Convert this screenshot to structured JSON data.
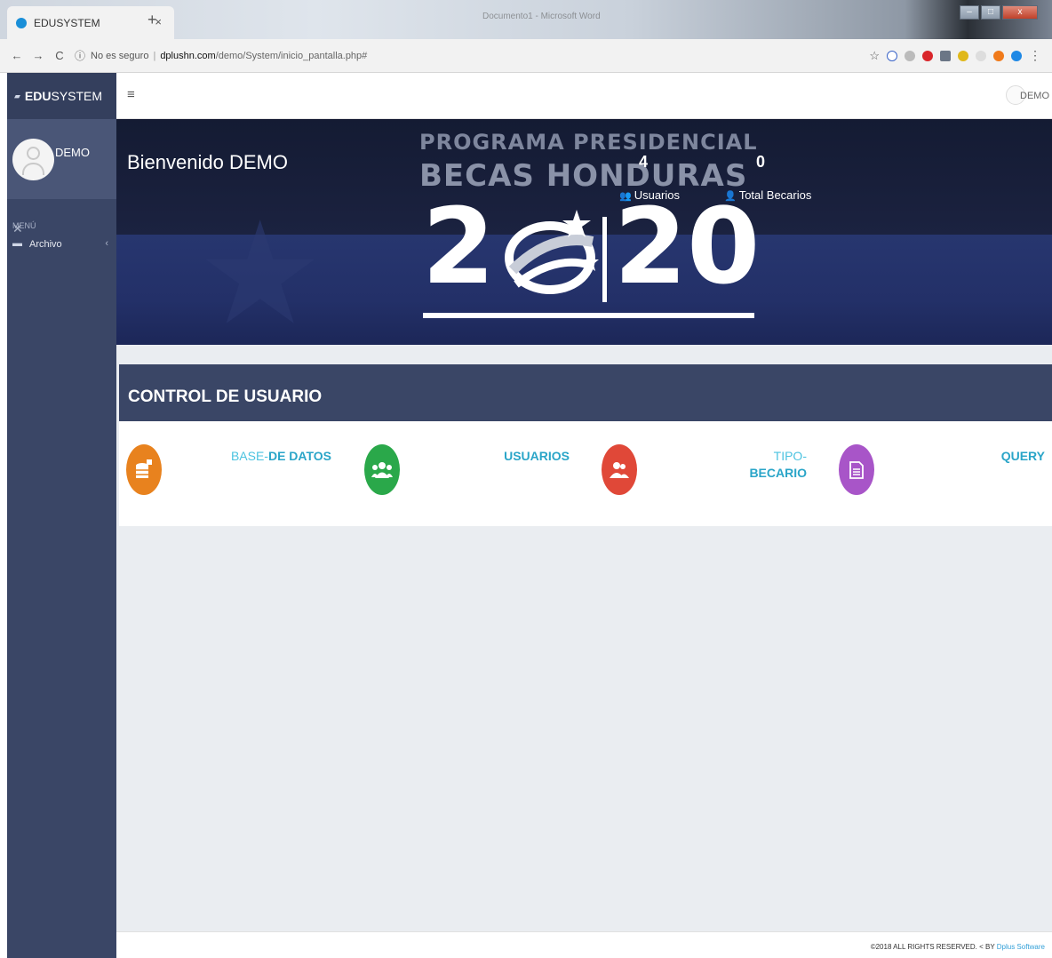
{
  "browser": {
    "tab_title": "EDUSYSTEM",
    "tab_close": "×",
    "new_tab": "+",
    "ghost_title": "Documento1 - Microsoft Word",
    "back": "←",
    "forward": "→",
    "reload": "C",
    "security_text": "No es seguro",
    "url_domain": "dplushn.com",
    "url_path": "/demo/System/inicio_pantalla.php#",
    "bookmark_icon": "☆",
    "menu_icon": "⋮"
  },
  "sidebar": {
    "brand_bold": "EDU",
    "brand_rest": "SYSTEM",
    "profile_name": "DEMO",
    "menu_header": "MENÚ",
    "items": [
      {
        "label": "Archivo",
        "arrow": "‹"
      }
    ]
  },
  "topbar": {
    "hamburger": "≡",
    "user_name": "DEMO"
  },
  "banner": {
    "welcome": "Bienvenido DEMO",
    "logo_line1": "PROGRAMA PRESIDENCIAL",
    "logo_line2": "BECAS HONDURAS",
    "logo_year_a": "2",
    "logo_year_b": "20",
    "stats": [
      {
        "value": "4",
        "label": "Usuarios"
      },
      {
        "value": "0",
        "label": "Total Becarios"
      }
    ]
  },
  "section": {
    "title": "CONTROL DE USUARIO",
    "tiles": [
      {
        "icon": "database-icon",
        "color": "#e8821e",
        "label_light": "BASE-",
        "label_bold": "DE DATOS"
      },
      {
        "icon": "users-icon",
        "color": "#2aa84a",
        "label_light": "",
        "label_bold": "USUARIOS"
      },
      {
        "icon": "user-type-icon",
        "color": "#e04838",
        "label_light": "TIPO-",
        "label_bold": "BECARIO"
      },
      {
        "icon": "document-icon",
        "color": "#a855c8",
        "label_light": "",
        "label_bold": "QUERY"
      }
    ]
  },
  "footer": {
    "text": "©2018 ALL RIGHTS RESERVED. ",
    "by": "BY ",
    "link": "Dplus Software"
  }
}
